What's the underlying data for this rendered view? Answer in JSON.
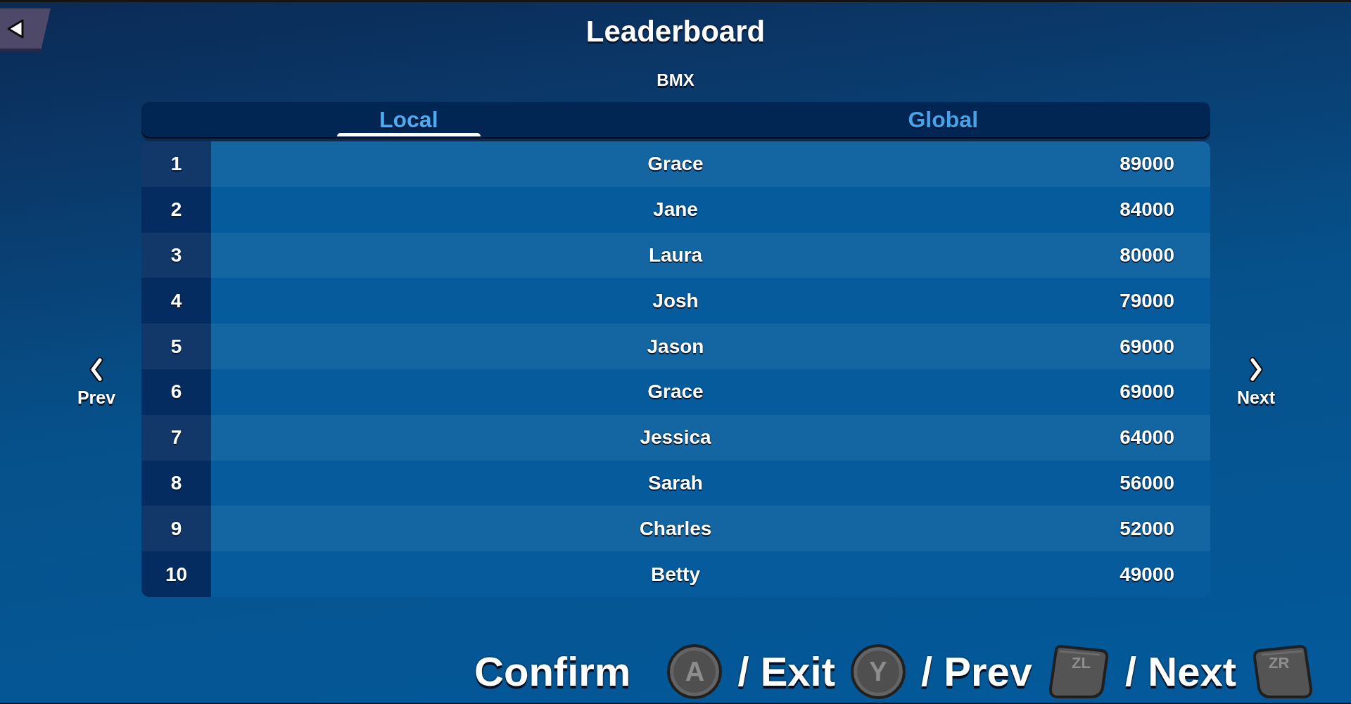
{
  "header": {
    "title": "Leaderboard",
    "subtitle": "BMX"
  },
  "tabs": [
    {
      "label": "Local",
      "selected": true
    },
    {
      "label": "Global",
      "selected": false
    }
  ],
  "leaderboard": {
    "rows": [
      {
        "rank": "1",
        "name": "Grace",
        "score": "89000"
      },
      {
        "rank": "2",
        "name": "Jane",
        "score": "84000"
      },
      {
        "rank": "3",
        "name": "Laura",
        "score": "80000"
      },
      {
        "rank": "4",
        "name": "Josh",
        "score": "79000"
      },
      {
        "rank": "5",
        "name": "Jason",
        "score": "69000"
      },
      {
        "rank": "6",
        "name": "Grace",
        "score": "69000"
      },
      {
        "rank": "7",
        "name": "Jessica",
        "score": "64000"
      },
      {
        "rank": "8",
        "name": "Sarah",
        "score": "56000"
      },
      {
        "rank": "9",
        "name": "Charles",
        "score": "52000"
      },
      {
        "rank": "10",
        "name": "Betty",
        "score": "49000"
      }
    ]
  },
  "pager": {
    "prev": "Prev",
    "next": "Next"
  },
  "button_hints": [
    {
      "label": "Confirm",
      "key": "A",
      "kind": "round"
    },
    {
      "label": "/ Exit",
      "key": "Y",
      "kind": "round"
    },
    {
      "label": "/ Prev",
      "key": "ZL",
      "kind": "ltrigger"
    },
    {
      "label": "/ Next",
      "key": "ZR",
      "kind": "rtrigger"
    }
  ]
}
